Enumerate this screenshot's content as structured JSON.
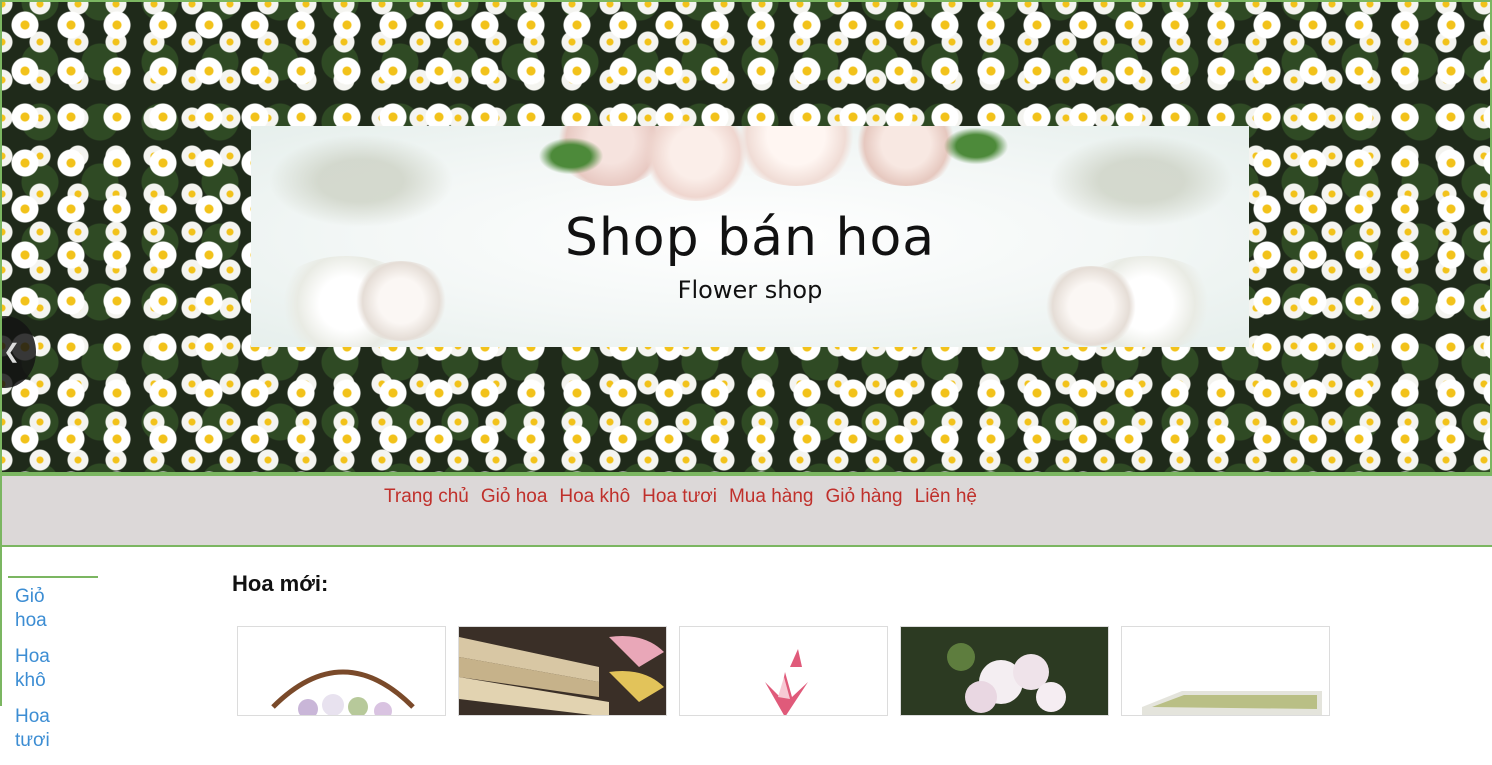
{
  "banner": {
    "title": "Shop bán hoa",
    "subtitle": "Flower shop"
  },
  "nav": {
    "items": [
      "Trang chủ",
      "Giỏ hoa",
      "Hoa khô",
      "Hoa tươi",
      "Mua hàng",
      "Giỏ hàng",
      "Liên hệ"
    ]
  },
  "sidebar": {
    "items": [
      "Giỏ hoa",
      "Hoa khô",
      "Hoa tươi"
    ]
  },
  "main": {
    "section_title": "Hoa mới:"
  },
  "colors": {
    "frame": "#7bb661",
    "nav_link": "#c0302b",
    "sidebar_link": "#3c8dd3",
    "nav_bg": "#dcd8d8"
  }
}
